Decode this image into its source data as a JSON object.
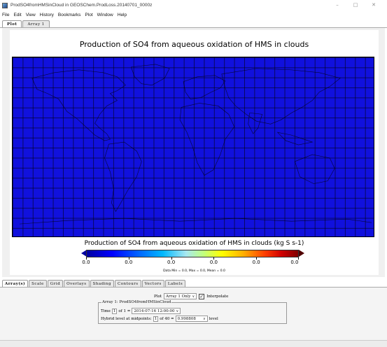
{
  "window": {
    "title": "ProdSO4fromHMSinCloud in GEOSChem.ProdLoss.20140701_0000z",
    "controls": [
      "–",
      "□",
      "✕"
    ]
  },
  "menu": [
    "File",
    "Edit",
    "View",
    "History",
    "Bookmarks",
    "Plot",
    "Window",
    "Help"
  ],
  "top_tabs": [
    "Plot",
    "Array 1"
  ],
  "plot": {
    "title": "Production of SO4 from aqueous oxidation of HMS in clouds",
    "colorbar_title": "Production of SO4 from aqueous oxidation of HMS in clouds (kg S s-1)",
    "colorbar_labels": [
      "0.0",
      "0.0",
      "0.0",
      "0.0",
      "0.0",
      "0.0"
    ],
    "stats": "Data Min = 0.0, Max = 0.0, Mean = 0.0",
    "map_fill_color": "#1111dd"
  },
  "chart_data": {
    "type": "heatmap",
    "title": "Production of SO4 from aqueous oxidation of HMS in clouds",
    "colorbar_label": "Production of SO4 from aqueous oxidation of HMS in clouds (kg S s-1)",
    "colorbar_ticks": [
      0.0,
      0.0,
      0.0,
      0.0,
      0.0,
      0.0
    ],
    "data_min": 0.0,
    "data_max": 0.0,
    "data_mean": 0.0,
    "grid": true
  },
  "bottom_tabs": [
    "Array(s)",
    "Scale",
    "Grid",
    "Overlays",
    "Shading",
    "Contours",
    "Vectors",
    "Labels"
  ],
  "controls": {
    "plot_label": "Plot",
    "plot_select": "Array 1 Only",
    "interpolate_label": "Interpolate",
    "interpolate_checked": "✓",
    "array_group_title": "Array 1: ProdSO4fromHMSinCloud",
    "time_label": "Time",
    "time_index": "1",
    "time_of": "of 1 =",
    "time_value": "2014-07-16 12:00:00",
    "level_label": "Hybrid level at midpoints:",
    "level_index": "1",
    "level_of": "of 40 =",
    "level_value": "0.998808",
    "level_unit": "level"
  }
}
